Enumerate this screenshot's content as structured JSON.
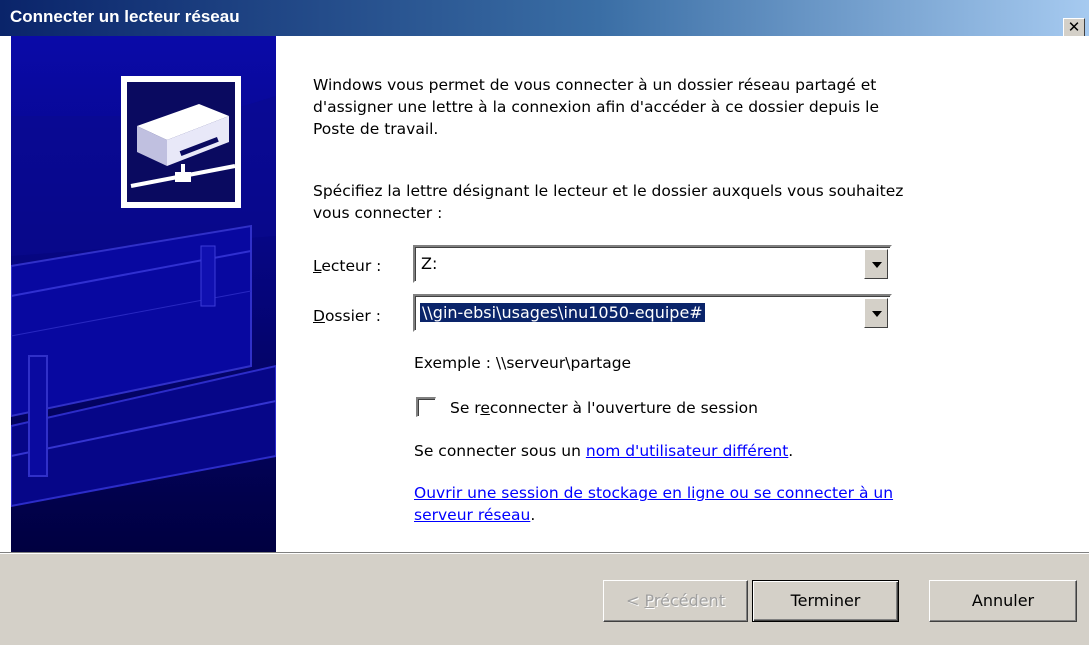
{
  "window": {
    "title": "Connecter un lecteur réseau"
  },
  "intro": {
    "line1": "Windows vous permet de vous connecter à un dossier réseau partagé et",
    "line2": "d'assigner une lettre à la connexion afin d'accéder à ce dossier depuis le",
    "line3": "Poste de travail.",
    "line4": "Spécifiez la lettre désignant le lecteur et le dossier auxquels vous souhaitez",
    "line5": "vous connecter :"
  },
  "form": {
    "drive_label_accel": "L",
    "drive_label_rest": "ecteur :",
    "drive_value": "Z:",
    "folder_label_accel": "D",
    "folder_label_rest": "ossier :",
    "folder_value": "\\\\gin-ebsi\\usages\\inu1050-equipe#",
    "example": "Exemple : \\\\serveur\\partage",
    "reconnect_pre": "Se r",
    "reconnect_accel": "e",
    "reconnect_post": "connecter à l'ouverture de session",
    "reconnect_checked": false,
    "other_user_prefix": "Se connecter sous un ",
    "other_user_link": "nom d'utilisateur différent",
    "other_user_suffix": ".",
    "storage_link_line1": "Ouvrir une session de stockage en ligne ou se connecter à un",
    "storage_link_line2": "serveur réseau",
    "storage_link_suffix": "."
  },
  "buttons": {
    "back_pre": "< ",
    "back_accel": "P",
    "back_rest": "récédent",
    "finish": "Terminer",
    "cancel": "Annuler"
  },
  "colors": {
    "title_gradient_start": "#0a246a",
    "title_gradient_end": "#a6caf0",
    "side_art_dark": "#000040",
    "side_art_blue": "#0000a0",
    "link": "#0000ff"
  },
  "icons": {
    "side": "network-drive-illustration",
    "close": "close-icon"
  }
}
